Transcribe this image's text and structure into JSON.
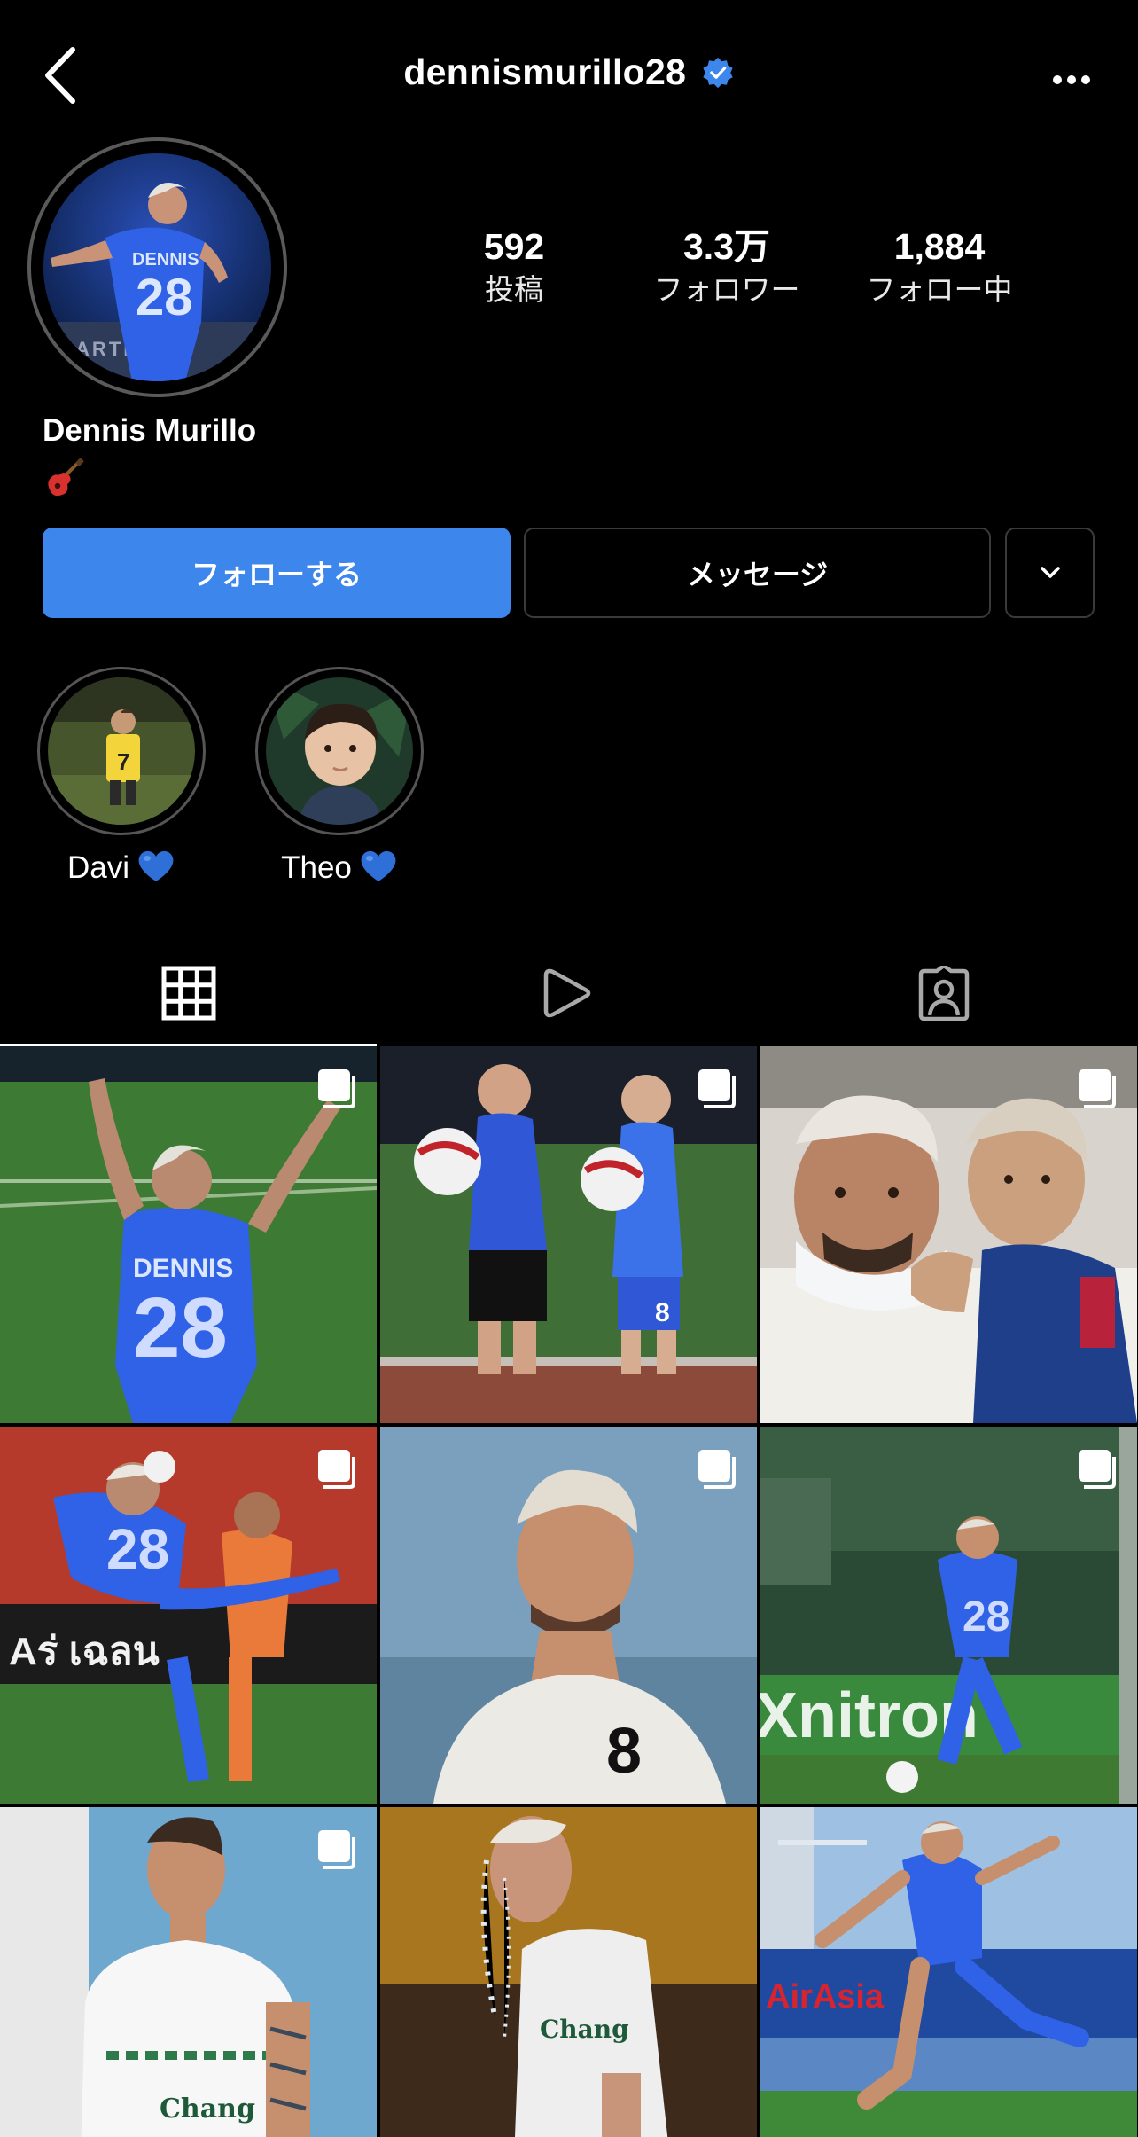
{
  "header": {
    "back_icon": "chevron-left-icon",
    "username": "dennismurillo28",
    "verified_icon": "verified-badge-icon",
    "more_icon": "ellipsis-icon"
  },
  "profile": {
    "display_name": "Dennis Murillo",
    "bio_emoji_icon": "guitar-emoji-icon"
  },
  "stats": [
    {
      "value": "592",
      "label": "投稿"
    },
    {
      "value": "3.3万",
      "label": "フォロワー"
    },
    {
      "value": "1,884",
      "label": "フォロー中"
    }
  ],
  "actions": {
    "follow_label": "フォローする",
    "message_label": "メッセージ",
    "suggest_icon": "chevron-down-icon"
  },
  "highlights": [
    {
      "label": "Davi",
      "icon": "blue-heart-icon"
    },
    {
      "label": "Theo",
      "icon": "blue-heart-icon"
    }
  ],
  "tabs": [
    {
      "icon": "grid-icon",
      "active": true
    },
    {
      "icon": "reels-play-icon",
      "active": false
    },
    {
      "icon": "tagged-person-icon",
      "active": false
    }
  ],
  "posts": [
    {
      "multi": true
    },
    {
      "multi": true
    },
    {
      "multi": true
    },
    {
      "multi": true
    },
    {
      "multi": true
    },
    {
      "multi": true
    },
    {
      "multi": true
    },
    {
      "multi": false
    },
    {
      "multi": false
    }
  ],
  "colors": {
    "background": "#000000",
    "follow_button": "#3d86ec",
    "verified": "#3d86ec",
    "heart": "#2f6fd8",
    "border": "#3a3a3a"
  }
}
